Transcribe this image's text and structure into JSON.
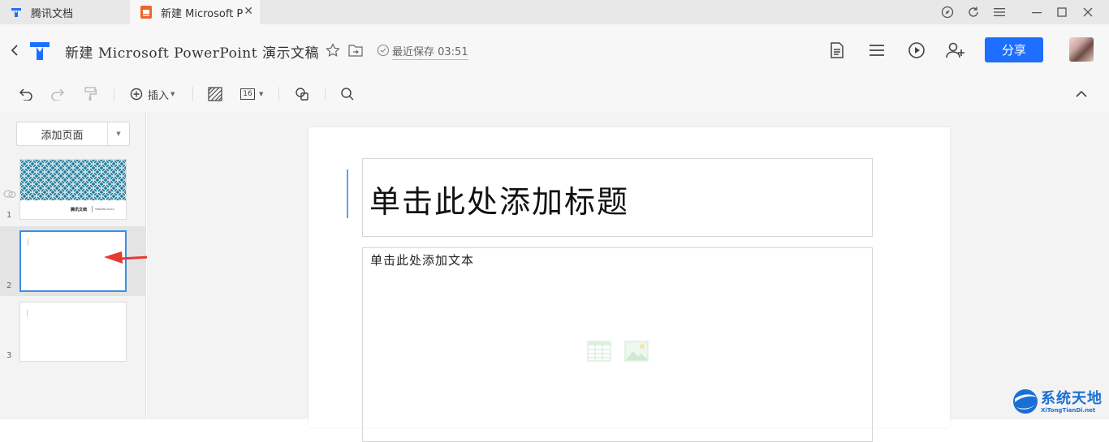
{
  "tabs": [
    {
      "label": "腾讯文档",
      "active": false
    },
    {
      "label": "新建 Microsoft P",
      "active": true
    }
  ],
  "header": {
    "doc_title": "新建 Microsoft PowerPoint 演示文稿",
    "save_status": "最近保存 03:51",
    "share_label": "分享"
  },
  "toolbar": {
    "insert_label": "插入",
    "font_size": "16"
  },
  "left_panel": {
    "add_page_label": "添加页面",
    "slides": [
      {
        "number": "1",
        "caption_left": "腾讯文档",
        "caption_right": "TENCENT DOCS"
      },
      {
        "number": "2"
      },
      {
        "number": "3"
      }
    ]
  },
  "slide": {
    "title_placeholder": "单击此处添加标题",
    "body_placeholder": "单击此处添加文本"
  },
  "watermark": {
    "brand": "系统天地",
    "url": "XiTongTianDi.net"
  },
  "colors": {
    "accent": "#1e6fff",
    "thumb_pattern": "#1f7a99",
    "arrow": "#e53935"
  }
}
